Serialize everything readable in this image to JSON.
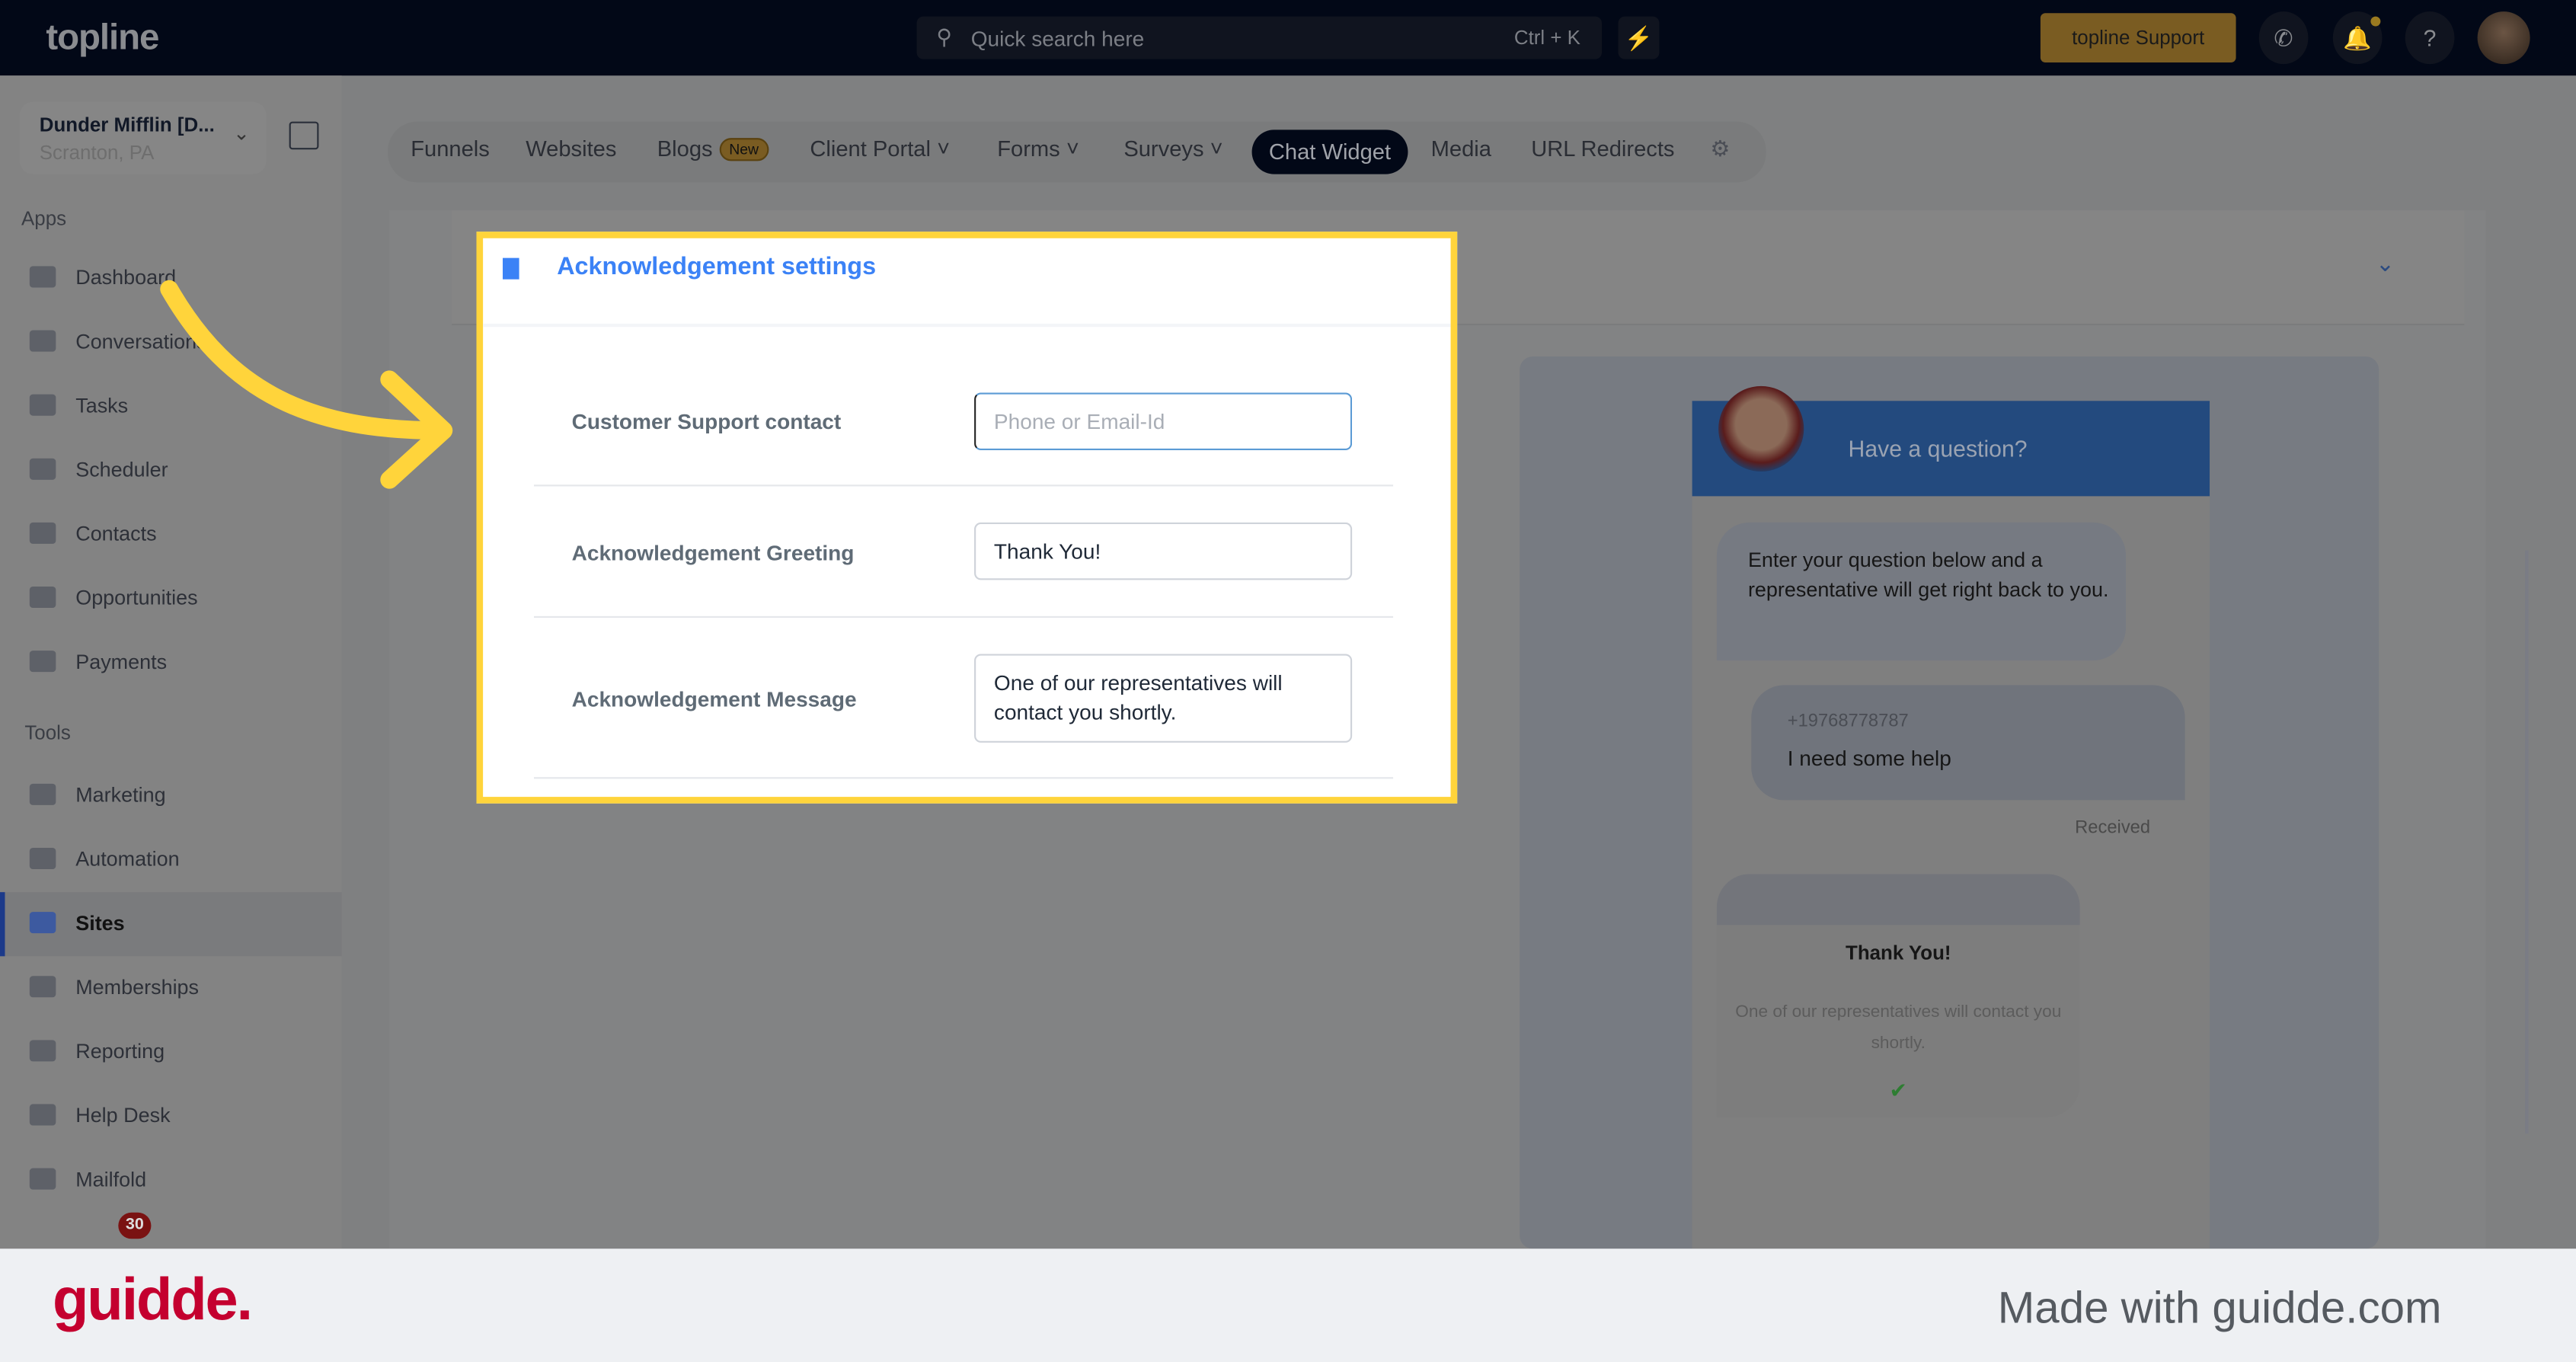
{
  "topbar": {
    "logo": "topline",
    "search_placeholder": "Quick search here",
    "search_shortcut": "Ctrl + K",
    "support_label": "topline Support"
  },
  "sidebar": {
    "account_name": "Dunder Mifflin [D...",
    "account_location": "Scranton, PA",
    "apps_heading": "Apps",
    "apps": [
      {
        "label": "Dashboard"
      },
      {
        "label": "Conversations"
      },
      {
        "label": "Tasks"
      },
      {
        "label": "Scheduler"
      },
      {
        "label": "Contacts"
      },
      {
        "label": "Opportunities"
      },
      {
        "label": "Payments"
      }
    ],
    "tools_heading": "Tools",
    "tools": [
      {
        "label": "Marketing"
      },
      {
        "label": "Automation"
      },
      {
        "label": "Sites",
        "active": true
      },
      {
        "label": "Memberships"
      },
      {
        "label": "Reporting"
      },
      {
        "label": "Help Desk"
      },
      {
        "label": "Mailfold"
      }
    ],
    "notification_count": "30"
  },
  "tabs": {
    "items": [
      "Funnels",
      "Websites",
      "Blogs",
      "Client Portal",
      "Forms",
      "Surveys",
      "Chat Widget",
      "Media",
      "URL Redirects"
    ],
    "blogs_badge": "New",
    "active": "Chat Widget"
  },
  "settings": {
    "title": "Acknowledgement settings",
    "fields": [
      {
        "label": "Customer Support contact",
        "value": "",
        "placeholder": "Phone or Email-Id"
      },
      {
        "label": "Acknowledgement Greeting",
        "value": "Thank You!"
      },
      {
        "label": "Acknowledgement Message",
        "value": "One of our representatives will contact you shortly."
      }
    ]
  },
  "preview": {
    "header": "Have a question?",
    "intro": "Enter your question below and a representative will get right back to you.",
    "phone": "+19768778787",
    "user_message": "I need some help",
    "status": "Received",
    "ack_title": "Thank You!",
    "ack_message": "One of our representatives will contact you shortly."
  },
  "footer": {
    "brand": "guidde.",
    "made_with": "Made with guidde.com"
  },
  "colors": {
    "highlight": "#ffd43b",
    "accent": "#3b82f6",
    "brand_red": "#c4002f"
  }
}
